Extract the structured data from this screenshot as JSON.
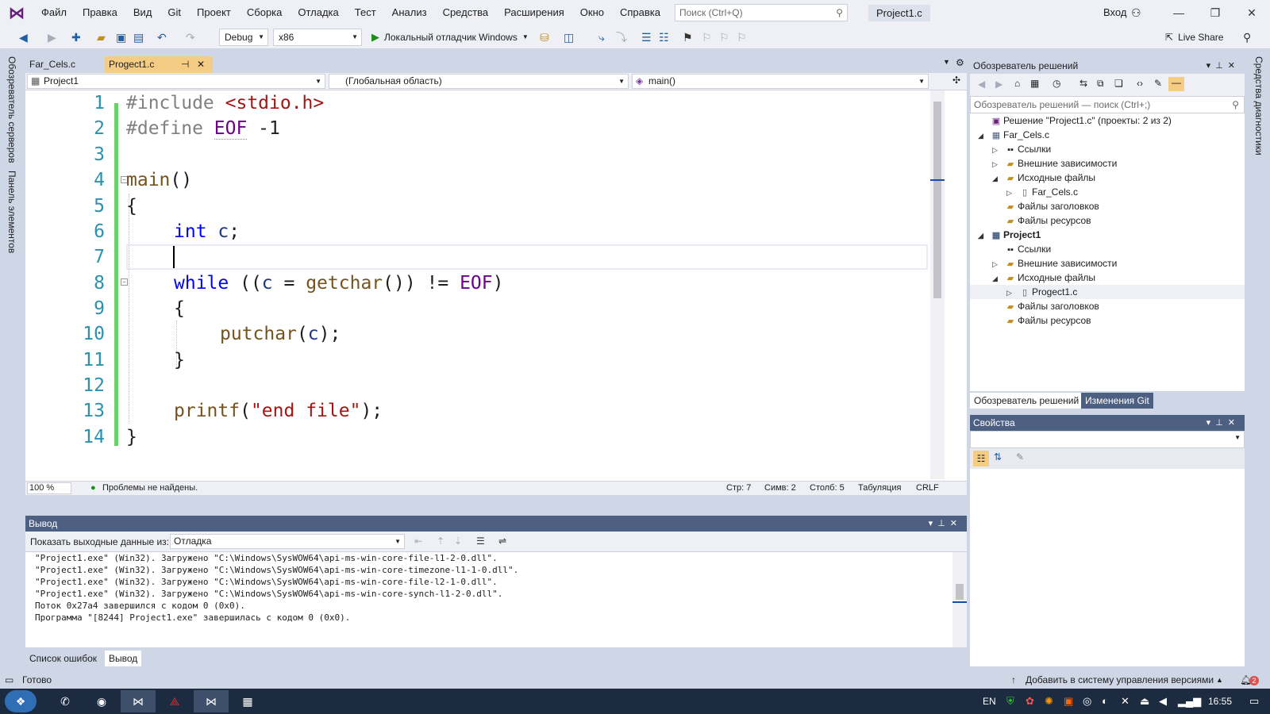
{
  "menu": {
    "items": [
      "Файл",
      "Правка",
      "Вид",
      "Git",
      "Проект",
      "Сборка",
      "Отладка",
      "Тест",
      "Анализ",
      "Средства",
      "Расширения",
      "Окно",
      "Справка"
    ],
    "search_placeholder": "Поиск (Ctrl+Q)",
    "project_title": "Project1.c",
    "signin": "Вход"
  },
  "toolbar": {
    "config": "Debug",
    "platform": "x86",
    "debugger": "Локальный отладчик Windows",
    "live_share": "Live Share"
  },
  "left_rail": {
    "server_explorer": "Обозреватель серверов",
    "toolbox": "Панель элементов"
  },
  "right_rail": {
    "diagnostics": "Средства диагностики"
  },
  "doc_tabs": [
    {
      "label": "Far_Cels.c",
      "active": false
    },
    {
      "label": "Progect1.c",
      "active": true
    }
  ],
  "navbar": {
    "project": "Project1",
    "scope": "(Глобальная область)",
    "member": "main()"
  },
  "code": {
    "line_numbers": [
      "1",
      "2",
      "3",
      "4",
      "5",
      "6",
      "7",
      "8",
      "9",
      "10",
      "11",
      "12",
      "13",
      "14"
    ],
    "l1_pp": "#include ",
    "l1_str": "<stdio.h>",
    "l2_pp": "#define ",
    "l2_mac": "EOF",
    "l2_rest": " -1",
    "l4_fn": "main",
    "l4_rest": "()",
    "l5": "{",
    "l6_kw": "int",
    "l6_var": "c",
    "l6_rest": ";",
    "l8_kw": "while",
    "l8_a": " ((",
    "l8_var": "c",
    "l8_b": " = ",
    "l8_fn": "getchar",
    "l8_c": "()) != ",
    "l8_mac": "EOF",
    "l8_d": ")",
    "l9": "{",
    "l10_fn": "putchar",
    "l10_a": "(",
    "l10_var": "c",
    "l10_b": ");",
    "l11": "}",
    "l13_fn": "printf",
    "l13_a": "(",
    "l13_str": "\"end file\"",
    "l13_b": ");",
    "l14": "}"
  },
  "editor_status": {
    "zoom": "100 %",
    "issues": "Проблемы не найдены.",
    "line": "Стр: 7",
    "char": "Симв: 2",
    "col": "Столб: 5",
    "indent": "Табуляция",
    "eol": "CRLF"
  },
  "output": {
    "title": "Вывод",
    "show_from_label": "Показать выходные данные из:",
    "source": "Отладка",
    "lines": [
      "\"Project1.exe\" (Win32). Загружено \"C:\\Windows\\SysWOW64\\api-ms-win-core-file-l1-2-0.dll\".",
      "\"Project1.exe\" (Win32). Загружено \"C:\\Windows\\SysWOW64\\api-ms-win-core-timezone-l1-1-0.dll\".",
      "\"Project1.exe\" (Win32). Загружено \"C:\\Windows\\SysWOW64\\api-ms-win-core-file-l2-1-0.dll\".",
      "\"Project1.exe\" (Win32). Загружено \"C:\\Windows\\SysWOW64\\api-ms-win-core-synch-l1-2-0.dll\".",
      "Поток 0x27a4 завершился с кодом 0 (0x0).",
      "Программа \"[8244] Project1.exe\" завершилась с кодом 0 (0x0)."
    ],
    "tabs": [
      "Список ошибок",
      "Вывод"
    ]
  },
  "solution_explorer": {
    "title": "Обозреватель решений",
    "search_placeholder": "Обозреватель решений — поиск (Ctrl+;)",
    "tree": [
      {
        "label": "Решение \"Project1.c\" (проекты: 2 из 2)",
        "icon": "solution-icon",
        "exp": ""
      },
      {
        "label": "Far_Cels.c",
        "icon": "project-icon",
        "exp": "◢"
      },
      {
        "label": "Ссылки",
        "icon": "references-icon",
        "exp": "▷"
      },
      {
        "label": "Внешние зависимости",
        "icon": "folder-icon",
        "exp": "▷"
      },
      {
        "label": "Исходные файлы",
        "icon": "folder-icon",
        "exp": "◢"
      },
      {
        "label": "Far_Cels.c",
        "icon": "file-icon",
        "exp": "▷"
      },
      {
        "label": "Файлы заголовков",
        "icon": "folder-icon",
        "exp": ""
      },
      {
        "label": "Файлы ресурсов",
        "icon": "folder-icon",
        "exp": ""
      },
      {
        "label": "Project1",
        "icon": "project-icon",
        "exp": "◢"
      },
      {
        "label": "Ссылки",
        "icon": "references-icon",
        "exp": ""
      },
      {
        "label": "Внешние зависимости",
        "icon": "folder-icon",
        "exp": "▷"
      },
      {
        "label": "Исходные файлы",
        "icon": "folder-icon",
        "exp": "◢"
      },
      {
        "label": "Progect1.c",
        "icon": "file-icon",
        "exp": "▷"
      },
      {
        "label": "Файлы заголовков",
        "icon": "folder-icon",
        "exp": ""
      },
      {
        "label": "Файлы ресурсов",
        "icon": "folder-icon",
        "exp": ""
      }
    ],
    "tabs": [
      "Обозреватель решений",
      "Изменения Git"
    ]
  },
  "properties": {
    "title": "Свойства"
  },
  "statusbar": {
    "ready": "Готово",
    "vcs": "Добавить в систему управления версиями",
    "notifications": "2"
  },
  "taskbar": {
    "lang": "EN",
    "time": "16:55"
  },
  "colors": {
    "accent": "#68217a",
    "active_tab": "#f5cc84",
    "panel_header": "#4d6082",
    "change_bar": "#6ad16a"
  }
}
